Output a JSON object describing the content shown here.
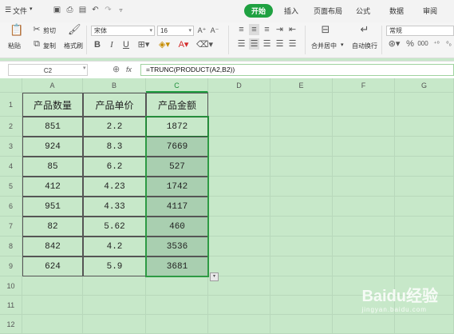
{
  "menu": {
    "file_label": "文件"
  },
  "tabs": [
    {
      "label": "开始",
      "active": true
    },
    {
      "label": "插入",
      "active": false
    },
    {
      "label": "页面布局",
      "active": false
    },
    {
      "label": "公式",
      "active": false
    },
    {
      "label": "数据",
      "active": false
    },
    {
      "label": "审阅",
      "active": false
    }
  ],
  "ribbon": {
    "paste": "粘贴",
    "cut": "剪切",
    "copy": "复制",
    "format_painter": "格式刷",
    "font_name": "宋体",
    "font_size": "16",
    "merge_center": "合并居中",
    "wrap_text": "自动换行",
    "number_format": "常规"
  },
  "formula_bar": {
    "name_box": "C2",
    "fx": "fx",
    "formula": "=TRUNC(PRODUCT(A2,B2))"
  },
  "sheet": {
    "columns": [
      "A",
      "B",
      "C",
      "D",
      "E",
      "F",
      "G"
    ],
    "rows": [
      "1",
      "2",
      "3",
      "4",
      "5",
      "6",
      "7",
      "8",
      "9",
      "10",
      "11",
      "12"
    ],
    "header_row": [
      "产品数量",
      "产品单价",
      "产品金额"
    ],
    "data": [
      [
        "851",
        "2.2",
        "1872"
      ],
      [
        "924",
        "8.3",
        "7669"
      ],
      [
        "85",
        "6.2",
        "527"
      ],
      [
        "412",
        "4.23",
        "1742"
      ],
      [
        "951",
        "4.33",
        "4117"
      ],
      [
        "82",
        "5.62",
        "460"
      ],
      [
        "842",
        "4.2",
        "3536"
      ],
      [
        "624",
        "5.9",
        "3681"
      ]
    ]
  },
  "colors": {
    "accent": "#1fa141",
    "sheet_bg": "#c7e8c9",
    "selection": "#a9cfb0"
  },
  "watermark": {
    "brand": "Baidu经验",
    "url": "jingyan.baidu.com"
  }
}
